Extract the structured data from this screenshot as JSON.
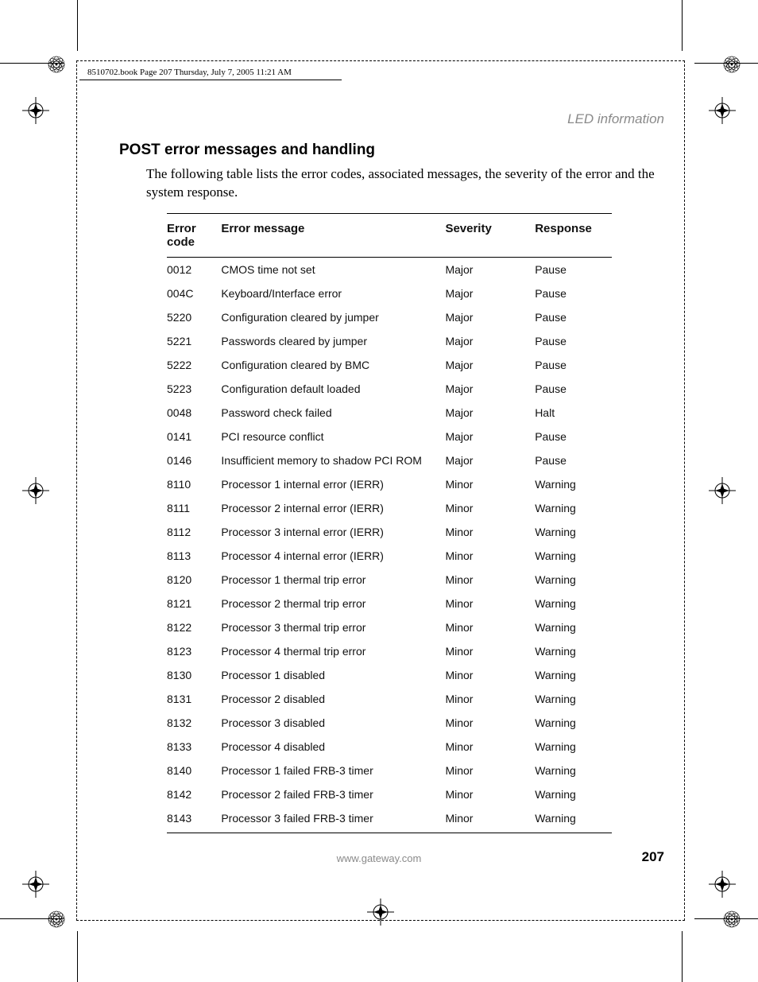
{
  "header_note": "8510702.book  Page 207  Thursday, July 7, 2005  11:21 AM",
  "running_head": "LED information",
  "heading": "POST error messages and handling",
  "intro": "The following table lists the error codes, associated messages, the severity of the error and the system response.",
  "table": {
    "headers": {
      "code": "Error code",
      "message": "Error message",
      "severity": "Severity",
      "response": "Response"
    },
    "rows": [
      {
        "code": "0012",
        "message": "CMOS time not set",
        "severity": "Major",
        "response": "Pause"
      },
      {
        "code": "004C",
        "message": "Keyboard/Interface error",
        "severity": "Major",
        "response": "Pause"
      },
      {
        "code": "5220",
        "message": "Configuration cleared by jumper",
        "severity": "Major",
        "response": "Pause"
      },
      {
        "code": "5221",
        "message": "Passwords cleared by jumper",
        "severity": "Major",
        "response": "Pause"
      },
      {
        "code": "5222",
        "message": "Configuration cleared by BMC",
        "severity": "Major",
        "response": "Pause"
      },
      {
        "code": "5223",
        "message": "Configuration default loaded",
        "severity": "Major",
        "response": "Pause"
      },
      {
        "code": "0048",
        "message": "Password check failed",
        "severity": "Major",
        "response": "Halt"
      },
      {
        "code": "0141",
        "message": "PCI resource conflict",
        "severity": "Major",
        "response": "Pause"
      },
      {
        "code": "0146",
        "message": "Insufficient memory to shadow PCI ROM",
        "severity": "Major",
        "response": "Pause"
      },
      {
        "code": "8110",
        "message": "Processor 1 internal error (IERR)",
        "severity": "Minor",
        "response": "Warning"
      },
      {
        "code": "8111",
        "message": "Processor 2 internal error (IERR)",
        "severity": "Minor",
        "response": "Warning"
      },
      {
        "code": "8112",
        "message": "Processor 3 internal error (IERR)",
        "severity": "Minor",
        "response": "Warning"
      },
      {
        "code": "8113",
        "message": "Processor 4 internal error (IERR)",
        "severity": "Minor",
        "response": "Warning"
      },
      {
        "code": "8120",
        "message": "Processor 1 thermal trip error",
        "severity": "Minor",
        "response": "Warning"
      },
      {
        "code": "8121",
        "message": "Processor 2 thermal trip error",
        "severity": "Minor",
        "response": "Warning"
      },
      {
        "code": "8122",
        "message": "Processor 3 thermal trip error",
        "severity": "Minor",
        "response": "Warning"
      },
      {
        "code": "8123",
        "message": "Processor 4 thermal trip error",
        "severity": "Minor",
        "response": "Warning"
      },
      {
        "code": "8130",
        "message": "Processor 1 disabled",
        "severity": "Minor",
        "response": "Warning"
      },
      {
        "code": "8131",
        "message": "Processor 2 disabled",
        "severity": "Minor",
        "response": "Warning"
      },
      {
        "code": "8132",
        "message": "Processor 3 disabled",
        "severity": "Minor",
        "response": "Warning"
      },
      {
        "code": "8133",
        "message": "Processor 4 disabled",
        "severity": "Minor",
        "response": "Warning"
      },
      {
        "code": "8140",
        "message": "Processor 1 failed FRB-3 timer",
        "severity": "Minor",
        "response": "Warning"
      },
      {
        "code": "8142",
        "message": "Processor 2 failed FRB-3 timer",
        "severity": "Minor",
        "response": "Warning"
      },
      {
        "code": "8143",
        "message": "Processor 3 failed FRB-3 timer",
        "severity": "Minor",
        "response": "Warning"
      }
    ]
  },
  "footer_url": "www.gateway.com",
  "page_number": "207"
}
